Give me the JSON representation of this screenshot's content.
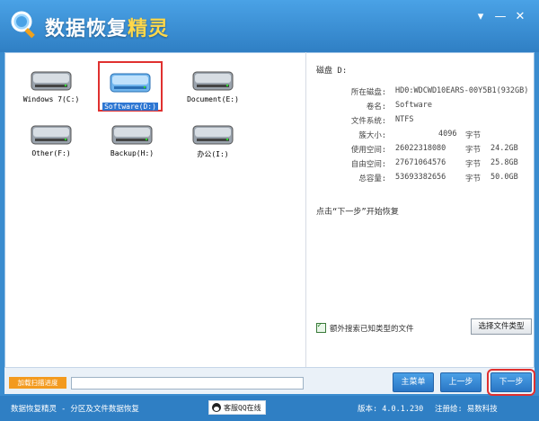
{
  "window": {
    "title_prefix": "数据恢复",
    "title_suffix": "精灵",
    "controls": {
      "menu": "▾",
      "minimize": "—",
      "close": "✕"
    }
  },
  "drives": [
    {
      "label": "Windows 7(C:)",
      "selected": false
    },
    {
      "label": "Software(D:)",
      "selected": true
    },
    {
      "label": "Document(E:)",
      "selected": false
    },
    {
      "label": "Other(F:)",
      "selected": false
    },
    {
      "label": "Backup(H:)",
      "selected": false
    },
    {
      "label": "办公(I:)",
      "selected": false
    }
  ],
  "disk_info": {
    "title": "磁盘 D:",
    "rows": [
      {
        "key": "所在磁盘:",
        "value": "HD0:WDCWD10EARS-00Y5B1(932GB)",
        "unit": "",
        "human": ""
      },
      {
        "key": "卷名:",
        "value": "Software",
        "unit": "",
        "human": ""
      },
      {
        "key": "文件系统:",
        "value": "NTFS",
        "unit": "",
        "human": ""
      },
      {
        "key": "簇大小:",
        "value": "4096",
        "unit": "字节",
        "human": ""
      },
      {
        "key": "使用空间:",
        "value": "26022318080",
        "unit": "字节",
        "human": "24.2GB"
      },
      {
        "key": "自由空间:",
        "value": "27671064576",
        "unit": "字节",
        "human": "25.8GB"
      },
      {
        "key": "总容量:",
        "value": "53693382656",
        "unit": "字节",
        "human": "50.0GB"
      }
    ],
    "hint": "点击“下一步”开始恢复"
  },
  "options": {
    "checkbox_label": "额外搜索已知类型的文件",
    "checked": true,
    "file_type_button": "选择文件类型"
  },
  "progress": {
    "label": "加载扫描进度",
    "fraction": 0
  },
  "buttons": {
    "main_menu": "主菜单",
    "prev": "上一步",
    "next": "下一步"
  },
  "status": {
    "left": "数据恢复精灵 - 分区及文件数据恢复",
    "qq": "客服QQ在线",
    "version": "版本: 4.0.1.230",
    "user": "注册给: 易数科技"
  },
  "colors": {
    "title_blue": "#2f7fc4",
    "accent_yellow": "#ffd84a",
    "selection_red": "#e0302f",
    "progress_orange": "#f39a1e"
  }
}
